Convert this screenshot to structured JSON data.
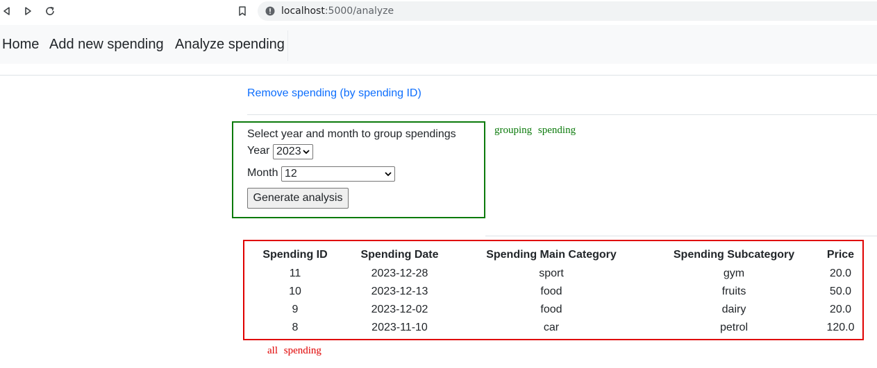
{
  "browser": {
    "url_host": "localhost",
    "url_path": ":5000/analyze"
  },
  "navbar": {
    "items": [
      {
        "label": "Home"
      },
      {
        "label": "Add new spending"
      },
      {
        "label": "Analyze spending"
      }
    ]
  },
  "remove_link": "Remove spending (by spending ID)",
  "form": {
    "title": "Select year and month to group spendings",
    "year_label": "Year",
    "year_value": "2023",
    "month_label": "Month",
    "month_value": "12",
    "submit_label": "Generate analysis"
  },
  "annotations": {
    "grouping": "grouping spending",
    "all": "all spending"
  },
  "colors": {
    "link": "#0d6efd",
    "group_box": "#0b7a0b",
    "table_box": "#e00000",
    "navbar_bg": "#f8f9fa"
  },
  "table": {
    "headers": [
      "Spending ID",
      "Spending Date",
      "Spending Main Category",
      "Spending Subcategory",
      "Price"
    ],
    "rows": [
      [
        "11",
        "2023-12-28",
        "sport",
        "gym",
        "20.0"
      ],
      [
        "10",
        "2023-12-13",
        "food",
        "fruits",
        "50.0"
      ],
      [
        "9",
        "2023-12-02",
        "food",
        "dairy",
        "20.0"
      ],
      [
        "8",
        "2023-11-10",
        "car",
        "petrol",
        "120.0"
      ]
    ]
  }
}
